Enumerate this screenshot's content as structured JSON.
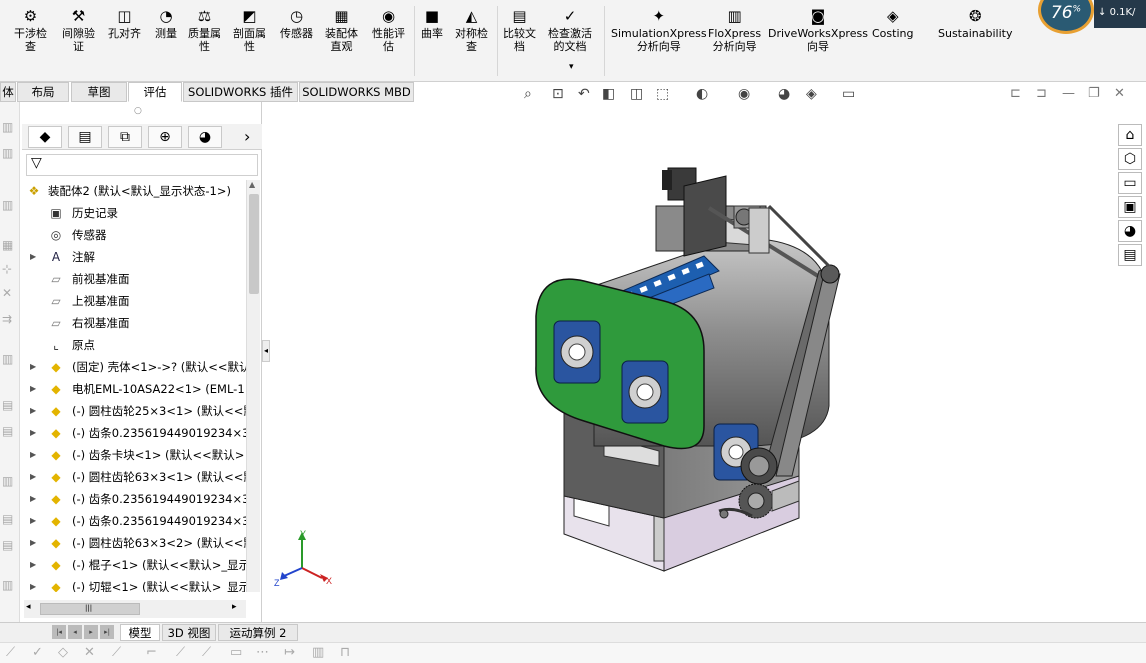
{
  "ribbon": {
    "buttons": [
      {
        "label": "干涉检\n查",
        "icon": "interference-check-icon",
        "glyph": "⚙"
      },
      {
        "label": "间隙验\n证",
        "icon": "clearance-verify-icon",
        "glyph": "⚒"
      },
      {
        "label": "孔对齐",
        "icon": "hole-align-icon",
        "glyph": "◫"
      },
      {
        "label": "测量",
        "icon": "measure-icon",
        "glyph": "◔"
      },
      {
        "label": "质量属\n性",
        "icon": "mass-properties-icon",
        "glyph": "⚖"
      },
      {
        "label": "剖面属\n性",
        "icon": "section-properties-icon",
        "glyph": "◩"
      },
      {
        "label": "传感器",
        "icon": "sensor-icon",
        "glyph": "◷"
      },
      {
        "label": "装配体\n直观",
        "icon": "assembly-visualization-icon",
        "glyph": "▦"
      },
      {
        "label": "性能评\n估",
        "icon": "performance-evaluation-icon",
        "glyph": "◉"
      },
      {
        "label": "曲率",
        "icon": "curvature-icon",
        "glyph": "■"
      },
      {
        "label": "对称检\n查",
        "icon": "symmetry-check-icon",
        "glyph": "◭"
      },
      {
        "label": "比较文\n档",
        "icon": "compare-documents-icon",
        "glyph": "▤"
      },
      {
        "label": "检查激活\n的文档",
        "icon": "check-active-document-icon",
        "glyph": "✓"
      },
      {
        "label": "SimulationXpress\n分析向导",
        "icon": "simulationxpress-icon",
        "glyph": "✦"
      },
      {
        "label": "FloXpress\n分析向导",
        "icon": "floxpress-icon",
        "glyph": "▥"
      },
      {
        "label": "DriveWorksXpress\n向导",
        "icon": "driveworksxpress-icon",
        "glyph": "◙"
      },
      {
        "label": "Costing",
        "icon": "costing-icon",
        "glyph": "◈"
      },
      {
        "label": "Sustainability",
        "icon": "sustainability-icon",
        "glyph": "❂"
      }
    ],
    "dropdown_glyph": "▾"
  },
  "gauge": {
    "value": "76",
    "unit": "%"
  },
  "network": {
    "glyph": "↓",
    "speed": "0.1K/"
  },
  "tabs": [
    {
      "label": "体"
    },
    {
      "label": "布局"
    },
    {
      "label": "草图"
    },
    {
      "label": "评估"
    },
    {
      "label": "SOLIDWORKS 插件"
    },
    {
      "label": "SOLIDWORKS MBD"
    }
  ],
  "featuremanager": {
    "tabs": [
      {
        "icon": "feature-manager-icon",
        "glyph": "◆"
      },
      {
        "icon": "property-manager-icon",
        "glyph": "▤"
      },
      {
        "icon": "configuration-manager-icon",
        "glyph": "⧉"
      },
      {
        "icon": "dimxpert-manager-icon",
        "glyph": "⊕"
      },
      {
        "icon": "display-manager-icon",
        "glyph": "◕"
      }
    ],
    "more_glyph": "›",
    "filter_glyph": "▽",
    "collapse_glyph": "▲",
    "tree": [
      {
        "label": "装配体2 (默认<默认_显示状态-1>)",
        "icon": "assembly-icon",
        "glyph": "❖",
        "expand": "",
        "indent": 0
      },
      {
        "label": "历史记录",
        "icon": "history-icon",
        "glyph": "▣",
        "expand": "",
        "indent": 1
      },
      {
        "label": "传感器",
        "icon": "sensor-icon",
        "glyph": "◎",
        "expand": "",
        "indent": 1
      },
      {
        "label": "注解",
        "icon": "annotation-icon",
        "glyph": "A",
        "expand": "▶",
        "indent": 1
      },
      {
        "label": "前视基准面",
        "icon": "plane-icon",
        "glyph": "▱",
        "expand": "",
        "indent": 1
      },
      {
        "label": "上视基准面",
        "icon": "plane-icon",
        "glyph": "▱",
        "expand": "",
        "indent": 1
      },
      {
        "label": "右视基准面",
        "icon": "plane-icon",
        "glyph": "▱",
        "expand": "",
        "indent": 1
      },
      {
        "label": "原点",
        "icon": "origin-icon",
        "glyph": "⌞",
        "expand": "",
        "indent": 1
      },
      {
        "label": "(固定) 壳体<1>->? (默认<<默认",
        "icon": "part-icon",
        "glyph": "◆",
        "expand": "▶",
        "indent": 1
      },
      {
        "label": "电机EML-10ASA22<1> (EML-1",
        "icon": "part-icon",
        "glyph": "◆",
        "expand": "▶",
        "indent": 1
      },
      {
        "label": "(-) 圆柱齿轮25×3<1> (默认<<默",
        "icon": "part-icon",
        "glyph": "◆",
        "expand": "▶",
        "indent": 1
      },
      {
        "label": "(-) 齿条0.235619449019234×3",
        "icon": "part-icon",
        "glyph": "◆",
        "expand": "▶",
        "indent": 1
      },
      {
        "label": "(-) 齿条卡块<1> (默认<<默认>",
        "icon": "part-icon",
        "glyph": "◆",
        "expand": "▶",
        "indent": 1
      },
      {
        "label": "(-) 圆柱齿轮63×3<1> (默认<<默",
        "icon": "part-icon",
        "glyph": "◆",
        "expand": "▶",
        "indent": 1
      },
      {
        "label": "(-) 齿条0.235619449019234×3",
        "icon": "part-icon",
        "glyph": "◆",
        "expand": "▶",
        "indent": 1
      },
      {
        "label": "(-) 齿条0.235619449019234×3",
        "icon": "part-icon",
        "glyph": "◆",
        "expand": "▶",
        "indent": 1
      },
      {
        "label": "(-) 圆柱齿轮63×3<2> (默认<<默",
        "icon": "part-icon",
        "glyph": "◆",
        "expand": "▶",
        "indent": 1
      },
      {
        "label": "(-) 棍子<1> (默认<<默认>_显示",
        "icon": "part-icon",
        "glyph": "◆",
        "expand": "▶",
        "indent": 1
      },
      {
        "label": "(-) 切辊<1> (默认<<默认>_显示",
        "icon": "part-icon",
        "glyph": "◆",
        "expand": "▶",
        "indent": 1
      }
    ],
    "scroll": {
      "left": "◂",
      "right": "▸",
      "grip": "|||"
    }
  },
  "view_toolbar": [
    {
      "icon": "zoom-to-fit-icon",
      "glyph": "⌕"
    },
    {
      "icon": "zoom-to-area-icon",
      "glyph": "⊡"
    },
    {
      "icon": "previous-view-icon",
      "glyph": "↶"
    },
    {
      "icon": "section-view-icon",
      "glyph": "◧"
    },
    {
      "icon": "dynamic-annotation-icon",
      "glyph": "◫"
    },
    {
      "icon": "view-orientation-icon",
      "glyph": "⬚"
    },
    {
      "icon": "display-style-icon",
      "glyph": "◐"
    },
    {
      "icon": "hide-show-items-icon",
      "glyph": "◉"
    },
    {
      "icon": "edit-appearance-icon",
      "glyph": "◕"
    },
    {
      "icon": "apply-scene-icon",
      "glyph": "◈"
    },
    {
      "icon": "view-settings-icon",
      "glyph": "▭"
    }
  ],
  "window_controls": [
    {
      "icon": "pane-left-icon",
      "glyph": "⊏"
    },
    {
      "icon": "pane-right-icon",
      "glyph": "⊐"
    },
    {
      "icon": "minimize-icon",
      "glyph": "—"
    },
    {
      "icon": "restore-icon",
      "glyph": "❐"
    },
    {
      "icon": "close-icon",
      "glyph": "✕"
    }
  ],
  "task_pane": [
    {
      "icon": "solidworks-resources-icon",
      "glyph": "⌂"
    },
    {
      "icon": "design-library-icon",
      "glyph": "⬡"
    },
    {
      "icon": "file-explorer-icon",
      "glyph": "▭"
    },
    {
      "icon": "view-palette-icon",
      "glyph": "▣"
    },
    {
      "icon": "appearances-icon",
      "glyph": "◕"
    },
    {
      "icon": "custom-properties-icon",
      "glyph": "▤"
    }
  ],
  "bottom_tabs": [
    {
      "label": "模型"
    },
    {
      "label": "3D 视图"
    },
    {
      "label": "运动算例 2"
    }
  ],
  "triad": {
    "x": "X",
    "y": "Y",
    "z": "Z"
  },
  "colors": {
    "ribbon_bg": "#f3f3f3",
    "panel_bg": "#f0f0f0",
    "green_plate": "#2f9a3c",
    "bearing_blue": "#2a55a0",
    "belt_gray": "#6a6a6a",
    "frame_purple": "#d9cde0",
    "housing_gray": "#9a9a9a"
  }
}
